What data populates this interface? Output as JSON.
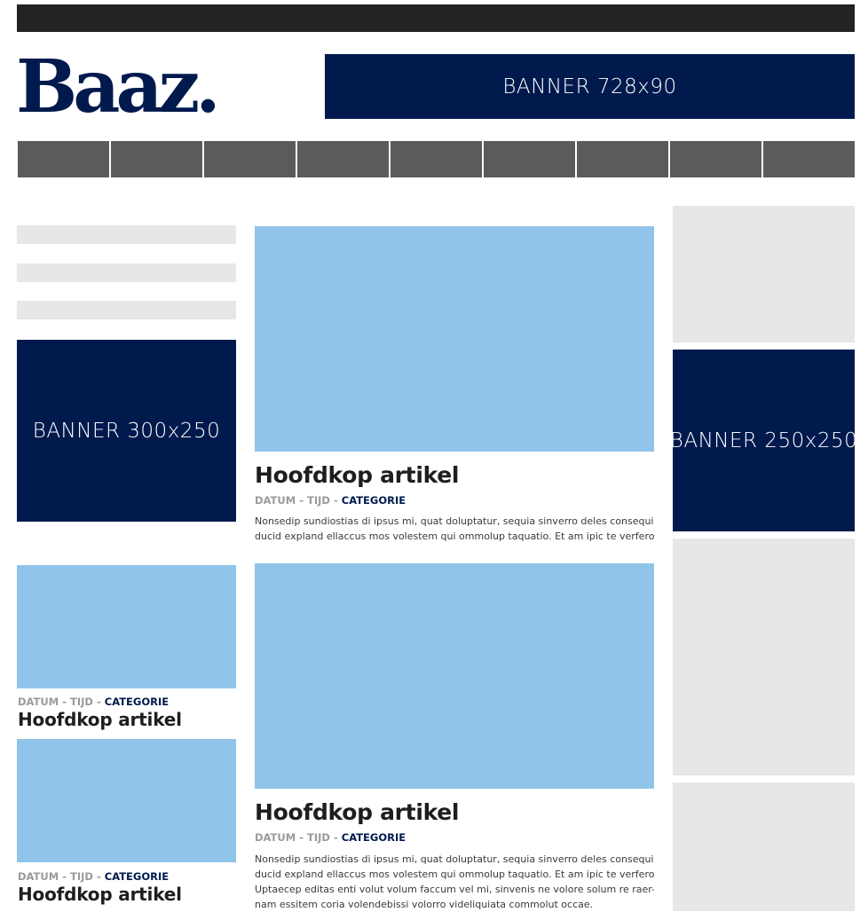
{
  "header": {
    "logo_text": "Baaz.",
    "banner_top": "BANNER 728x90"
  },
  "nav": {
    "items": [
      "",
      "",
      "",
      "",
      "",
      "",
      "",
      "",
      ""
    ]
  },
  "sidebar_left": {
    "banner": "BANNER 300x250",
    "articles": [
      {
        "datum": "DATUM",
        "tijd": "TIJD",
        "categorie": "CATEGORIE",
        "headline": "Hoofdkop artikel"
      },
      {
        "datum": "DATUM",
        "tijd": "TIJD",
        "categorie": "CATEGORIE",
        "headline": "Hoofdkop artikel"
      }
    ]
  },
  "main": {
    "articles": [
      {
        "headline": "Hoofdkop artikel",
        "datum": "DATUM",
        "tijd": "TIJD",
        "categorie": "CATEGORIE",
        "body_lines": [
          "Nonsedip sundiostias di ipsus mi, quat doluptatur, sequia sinverro deles consequi",
          "ducid expland ellaccus mos volestem qui ommolup taquatio. Et am ipic te verfero"
        ]
      },
      {
        "headline": "Hoofdkop artikel",
        "datum": "DATUM",
        "tijd": "TIJD",
        "categorie": "CATEGORIE",
        "body_lines": [
          "Nonsedip sundiostias di ipsus mi, quat doluptatur, sequia sinverro deles consequi",
          "ducid expland ellaccus mos volestem qui ommolup taquatio. Et am ipic te verfero",
          "Uptaecep editas enti volut volum faccum vel mi, sinvenis ne volore solum re raer-",
          "nam essitem coria volendebissi volorro videliquiata commolut occae."
        ]
      }
    ]
  },
  "sidebar_right": {
    "banner": "BANNER 250x250"
  },
  "separator": "-",
  "colors": {
    "navy": "#001a4d",
    "image_placeholder": "#91c4ea",
    "grey_placeholder": "#e6e7e8",
    "nav_bar": "#5a5b5d",
    "top_bar": "#232323"
  }
}
